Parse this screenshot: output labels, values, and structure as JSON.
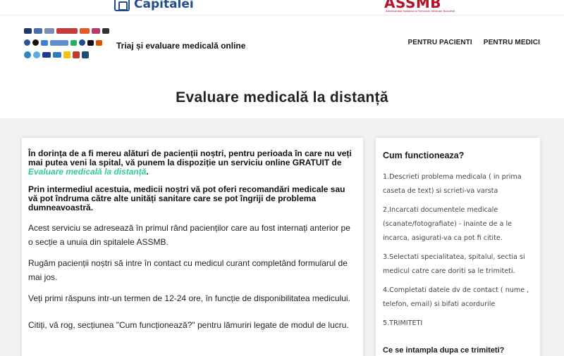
{
  "top_logos": {
    "left_text": "Capitalei",
    "right_text": "ASSMB",
    "right_subtitle": "Administrația Spitalelor și Serviciilor Medicale București"
  },
  "header": {
    "site_name": "Triaj și evaluare medicală online",
    "nav": [
      "PENTRU PACIENTI",
      "PENTRU MEDICI"
    ],
    "hospital_logo_colors": [
      [
        "#1d3a6e",
        "#4a6fa5",
        "#7a8fb3",
        "#c43b3b",
        "#e05a2a",
        "#b33a6a",
        "#333333"
      ],
      [
        "#2a5298",
        "#111111",
        "#3b7dd8",
        "#5a8fcf",
        "#27ae60",
        "#1d4f91",
        "#111111",
        "#d35400"
      ],
      [
        "#2e86c1",
        "#5dade2",
        "#1f3a93",
        "#2980b9",
        "#f1c40f",
        "#c0392b",
        "#1b4f72"
      ]
    ]
  },
  "page": {
    "title": "Evaluare medicală la distanță"
  },
  "main": {
    "intro_part1": "În dorința de a fi mereu alături de pacienții noștri, pentru perioada în care nu veți mai putea veni la spital, vă punem la dispoziție un serviciu online GRATUIT de ",
    "intro_highlight": "Evaluare medicală la distanță",
    "intro_part2": ".",
    "intro_2": "Prin intermediul acestuia, medicii noștri vă pot oferi recomandări medicale sau vă pot îndruma către alte unități sanitare care se pot îngriji de problema dumneavoastră.",
    "para_1": "Acest serviciu se adresează în primul rând pacienților care au fost internați anterior pe o secție a unuia din spitalele ASSMB.",
    "para_2": "Rugăm pacienții noștri să intre în contact cu medicul curant completând formularul de mai jos.",
    "para_3": "Veți primi răspuns intr-un termen de 12-24 ore, în funcție de disponibilitatea medicului.",
    "para_4": "Citiți, vă rog, secțiunea \"Cum funcționează?\" pentru lămuriri legate de modul de lucru."
  },
  "side": {
    "title": "Cum functioneaza?",
    "steps": [
      "1.Descrieti problema medicala ( in prima caseta de text) si scrieti-va varsta",
      "2.Incarcati documentele medicale (scanate/fotografiate) - inainte de a le incarca, asigurati-va ca pot fi citite.",
      "3.Selectati specialitatea, spitalul, sectia si medicul catre care doriti sa le trimiteti.",
      "4.Completati datele dv de contact ( nume , telefon, email) si bifati acordurile",
      "5.TRIMITETI"
    ],
    "subtitle": "Ce se intampla dupa ce trimiteti?"
  }
}
